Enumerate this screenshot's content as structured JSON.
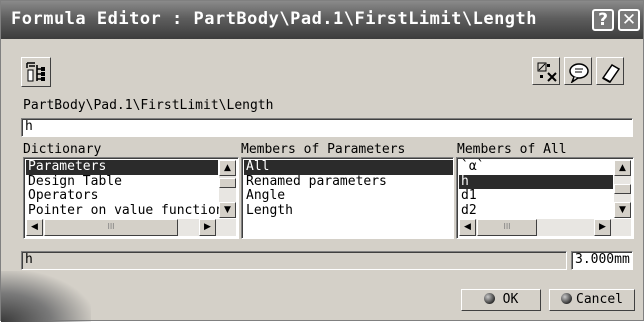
{
  "window": {
    "title": "Formula Editor : PartBody\\Pad.1\\FirstLimit\\Length",
    "help_glyph": "?",
    "close_glyph": "✕"
  },
  "toolbar": {
    "left_icon": "formula-tree-icon",
    "right_icons": [
      "measure-icon",
      "comment-icon",
      "eraser-icon"
    ]
  },
  "parameter_path": "PartBody\\Pad.1\\FirstLimit\\Length",
  "formula_input": "h",
  "dictionary": {
    "label": "Dictionary",
    "items": [
      "Parameters",
      "Design Table",
      "Operators",
      "Pointer on value function"
    ],
    "selected": 0
  },
  "members_of_parameters": {
    "label": "Members of Parameters",
    "items": [
      "All",
      "Renamed parameters",
      "Angle",
      "Length"
    ],
    "selected": 0
  },
  "members_of_all": {
    "label": "Members of All",
    "items": [
      "`α`",
      "h",
      "d1",
      "d2"
    ],
    "selected": 1
  },
  "scroll_glyphs": {
    "up": "▲",
    "down": "▼",
    "left": "◀",
    "right": "▶",
    "grip": "III"
  },
  "bottom": {
    "selected_name": "h",
    "value": "3.000mm"
  },
  "buttons": {
    "ok_label": "OK",
    "cancel_label": "Cancel"
  },
  "colors": {
    "selection": "#2b2b2b",
    "dialog_bg": "#d4d0c8",
    "titlebar": "#5e5e5e"
  }
}
